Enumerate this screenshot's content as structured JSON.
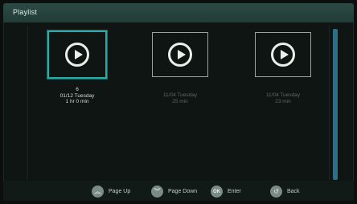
{
  "header": {
    "title": "Playlist"
  },
  "items": [
    {
      "number": "6",
      "date": "01/12  Tuesday",
      "duration": "1 hr 0 min"
    },
    {
      "date": "11/04  Tuesday",
      "duration": "25 min"
    },
    {
      "date": "11/04  Tuesday",
      "duration": "23 min"
    }
  ],
  "footer": {
    "page_up": "Page Up",
    "page_down": "Page Down",
    "ok_icon": "OK",
    "enter": "Enter",
    "back": "Back"
  },
  "icons": {
    "play": "play-icon",
    "page_up": "chevron-up-icon",
    "page_down": "chevron-down-icon",
    "back": "back-icon"
  }
}
